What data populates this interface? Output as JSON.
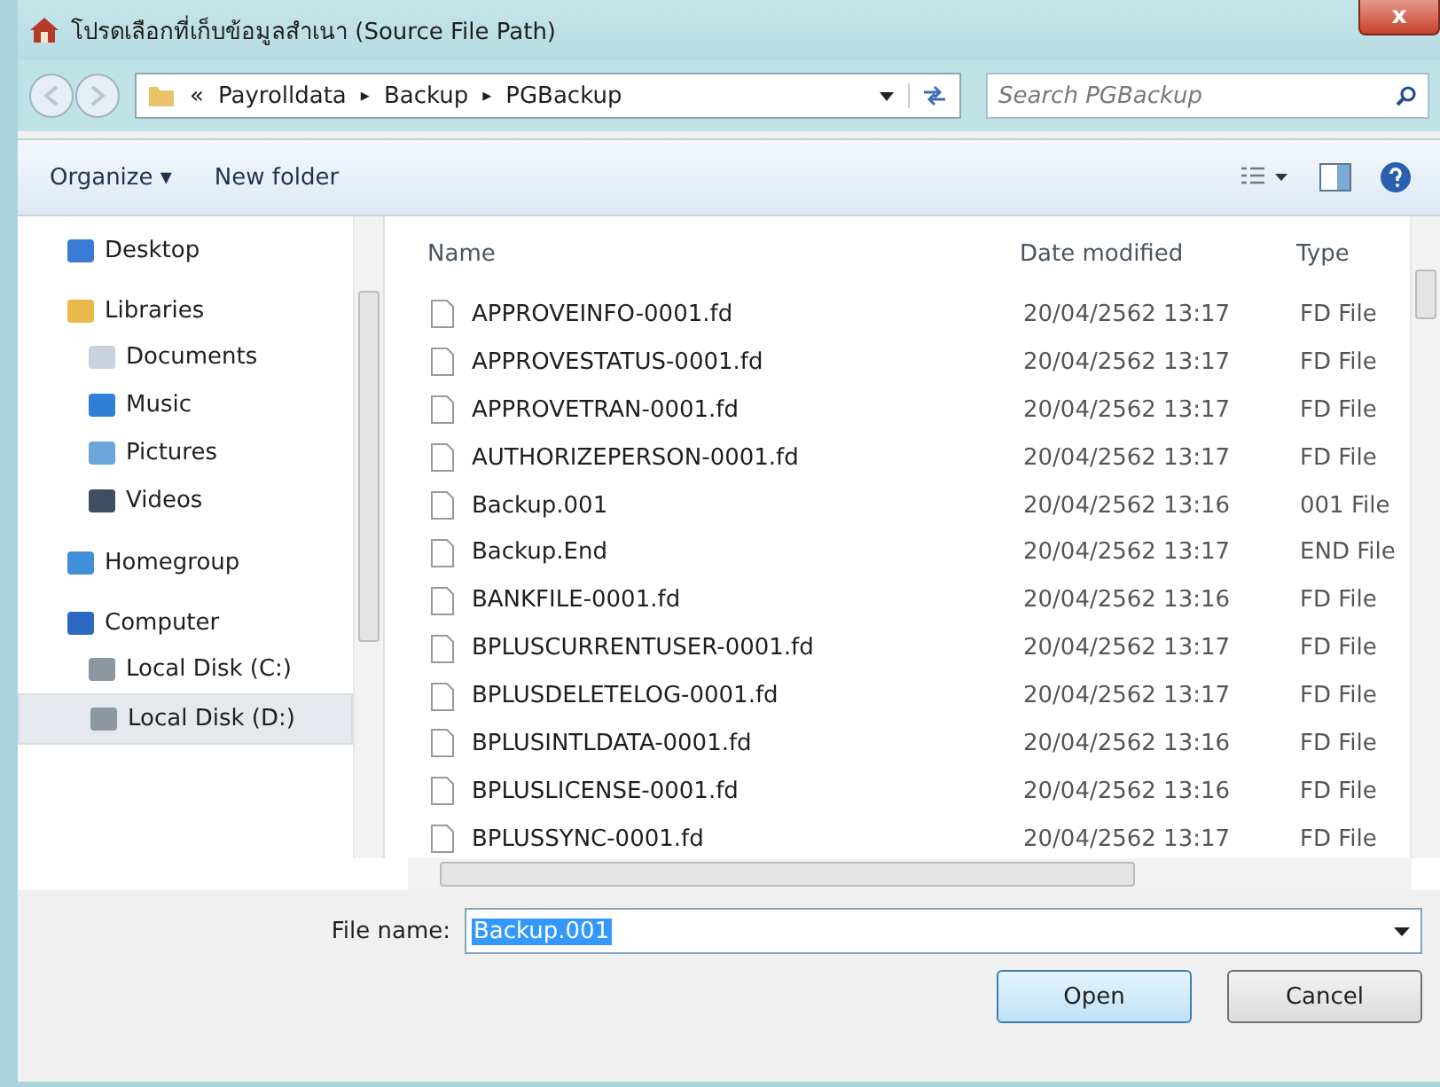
{
  "window": {
    "title": "โปรดเลือกที่เก็บข้อมูลสำเนา (Source File Path)",
    "close": "x"
  },
  "address": {
    "overflow": "«",
    "crumbs": [
      "Payrolldata",
      "Backup",
      "PGBackup"
    ],
    "separator": "▸"
  },
  "search": {
    "placeholder": "Search PGBackup"
  },
  "toolbar": {
    "organize": "Organize ▾",
    "new_folder": "New folder"
  },
  "sidebar": {
    "items": [
      {
        "label": "Desktop",
        "selected": false
      },
      {
        "label": "Libraries",
        "selected": false,
        "children": [
          {
            "label": "Documents",
            "selected": false
          },
          {
            "label": "Music",
            "selected": false
          },
          {
            "label": "Pictures",
            "selected": false
          },
          {
            "label": "Videos",
            "selected": false
          }
        ]
      },
      {
        "label": "Homegroup",
        "selected": false
      },
      {
        "label": "Computer",
        "selected": false,
        "children": [
          {
            "label": "Local Disk (C:)",
            "selected": false
          },
          {
            "label": "Local Disk (D:)",
            "selected": true
          }
        ]
      }
    ]
  },
  "table": {
    "columns": [
      "Name",
      "Date modified",
      "Type"
    ],
    "rows": [
      {
        "name": "APPROVEINFO-0001.fd",
        "date": "20/04/2562 13:17",
        "type": "FD File",
        "selected": false
      },
      {
        "name": "APPROVESTATUS-0001.fd",
        "date": "20/04/2562 13:17",
        "type": "FD File",
        "selected": false
      },
      {
        "name": "APPROVETRAN-0001.fd",
        "date": "20/04/2562 13:17",
        "type": "FD File",
        "selected": false
      },
      {
        "name": "AUTHORIZEPERSON-0001.fd",
        "date": "20/04/2562 13:17",
        "type": "FD File",
        "selected": false
      },
      {
        "name": "Backup.001",
        "date": "20/04/2562 13:16",
        "type": "001 File",
        "selected": false
      },
      {
        "name": "Backup.End",
        "date": "20/04/2562 13:17",
        "type": "END File",
        "selected": false
      },
      {
        "name": "BANKFILE-0001.fd",
        "date": "20/04/2562 13:16",
        "type": "FD File",
        "selected": false
      },
      {
        "name": "BPLUSCURRENTUSER-0001.fd",
        "date": "20/04/2562 13:17",
        "type": "FD File",
        "selected": false
      },
      {
        "name": "BPLUSDELETELOG-0001.fd",
        "date": "20/04/2562 13:17",
        "type": "FD File",
        "selected": false
      },
      {
        "name": "BPLUSINTLDATA-0001.fd",
        "date": "20/04/2562 13:16",
        "type": "FD File",
        "selected": false
      },
      {
        "name": "BPLUSLICENSE-0001.fd",
        "date": "20/04/2562 13:16",
        "type": "FD File",
        "selected": false
      },
      {
        "name": "BPLUSSYNC-0001.fd",
        "date": "20/04/2562 13:17",
        "type": "FD File",
        "selected": false
      }
    ]
  },
  "filename": {
    "label": "File name:",
    "value": "Backup.001"
  },
  "buttons": [
    {
      "label": "Open",
      "default": true
    },
    {
      "label": "Cancel",
      "default": false
    }
  ]
}
